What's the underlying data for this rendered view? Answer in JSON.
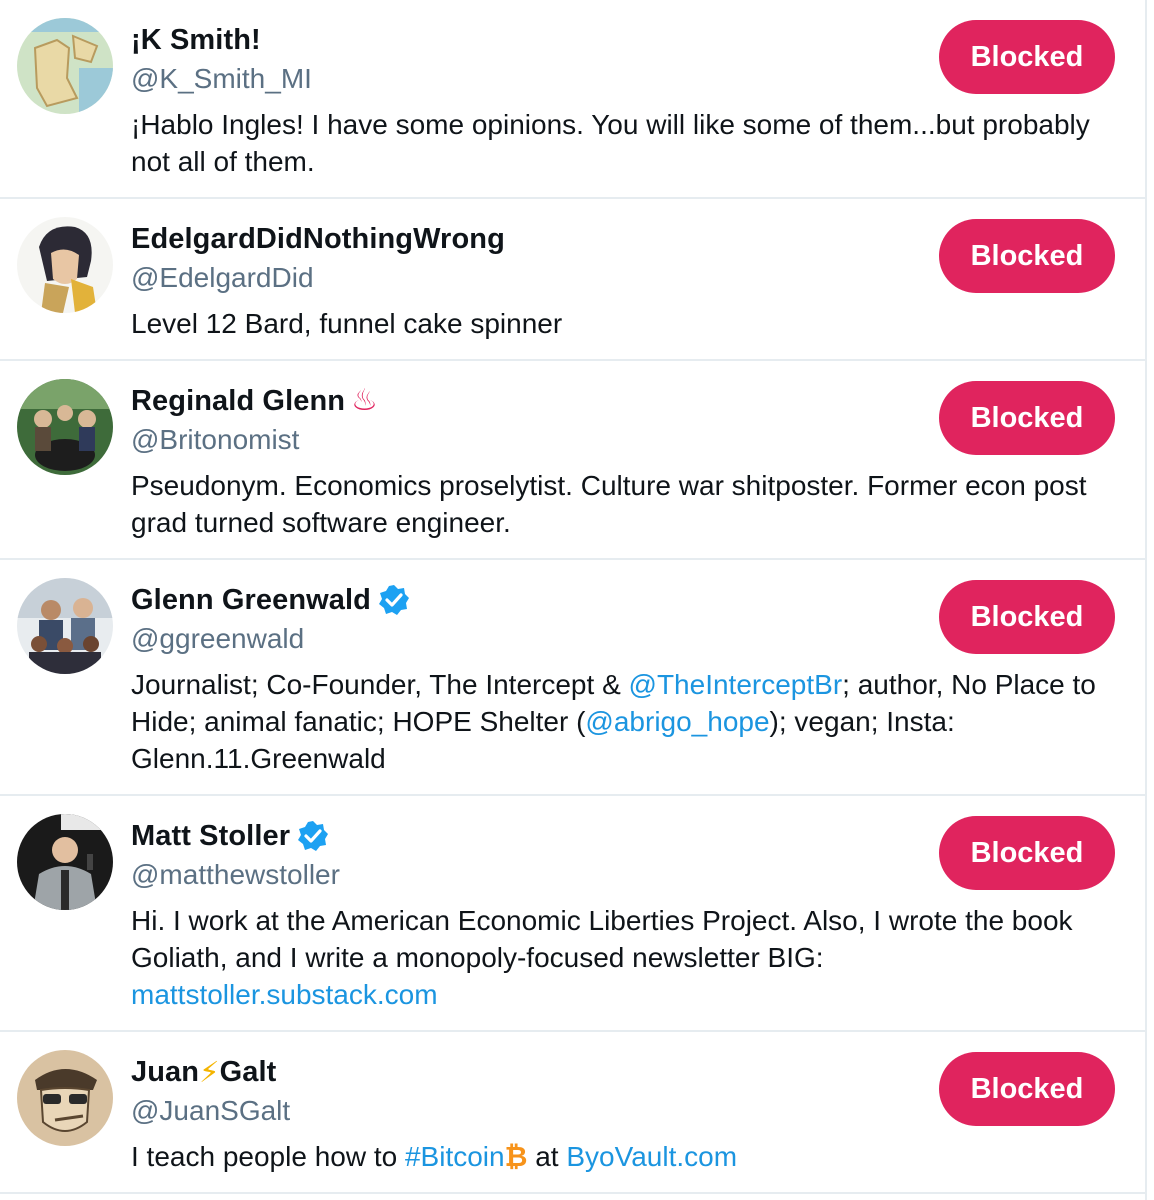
{
  "colors": {
    "accent": "#e0245e",
    "link": "#1b95e0",
    "muted": "#5b7083",
    "verified": "#1da1f2"
  },
  "accounts": [
    {
      "name": "¡K Smith!",
      "handle": "@K_Smith_MI",
      "button": "Blocked",
      "bio": {
        "t1": "¡Hablo Ingles! I have some opinions. You will like some of them...but probably not all of them."
      }
    },
    {
      "name": "EdelgardDidNothingWrong",
      "handle": "@EdelgardDid",
      "button": "Blocked",
      "bio": {
        "t1": "Level 12 Bard, funnel cake spinner"
      }
    },
    {
      "name": "Reginald Glenn",
      "name_emoji": "♨",
      "handle": "@Britonomist",
      "button": "Blocked",
      "bio": {
        "t1": "Pseudonym. Economics proselytist. Culture war shitposter. Former econ post grad turned software engineer."
      }
    },
    {
      "name": "Glenn Greenwald",
      "verified": true,
      "handle": "@ggreenwald",
      "button": "Blocked",
      "bio": {
        "t1": "Journalist; Co-Founder, The Intercept & ",
        "l1": "@TheInterceptBr",
        "t2": "; author, No Place to Hide; animal fanatic; HOPE Shelter (",
        "l2": "@abrigo_hope",
        "t3": "); vegan; Insta: Glenn.11.Greenwald"
      }
    },
    {
      "name": "Matt Stoller",
      "verified": true,
      "handle": "@matthewstoller",
      "button": "Blocked",
      "bio": {
        "t1": "Hi. I work at the American Economic Liberties Project. Also, I wrote the book Goliath, and I write a monopoly-focused newsletter BIG: ",
        "l1": "mattstoller.substack.com"
      }
    },
    {
      "name_a": "Juan",
      "name_emoji": "⚡",
      "name_b": "Galt",
      "handle": "@JuanSGalt",
      "button": "Blocked",
      "bio": {
        "t1": "I teach people how to ",
        "l1": "#Bitcoin",
        "e1": "₿",
        "t2": " at ",
        "l2": "ByoVault.com"
      }
    }
  ]
}
